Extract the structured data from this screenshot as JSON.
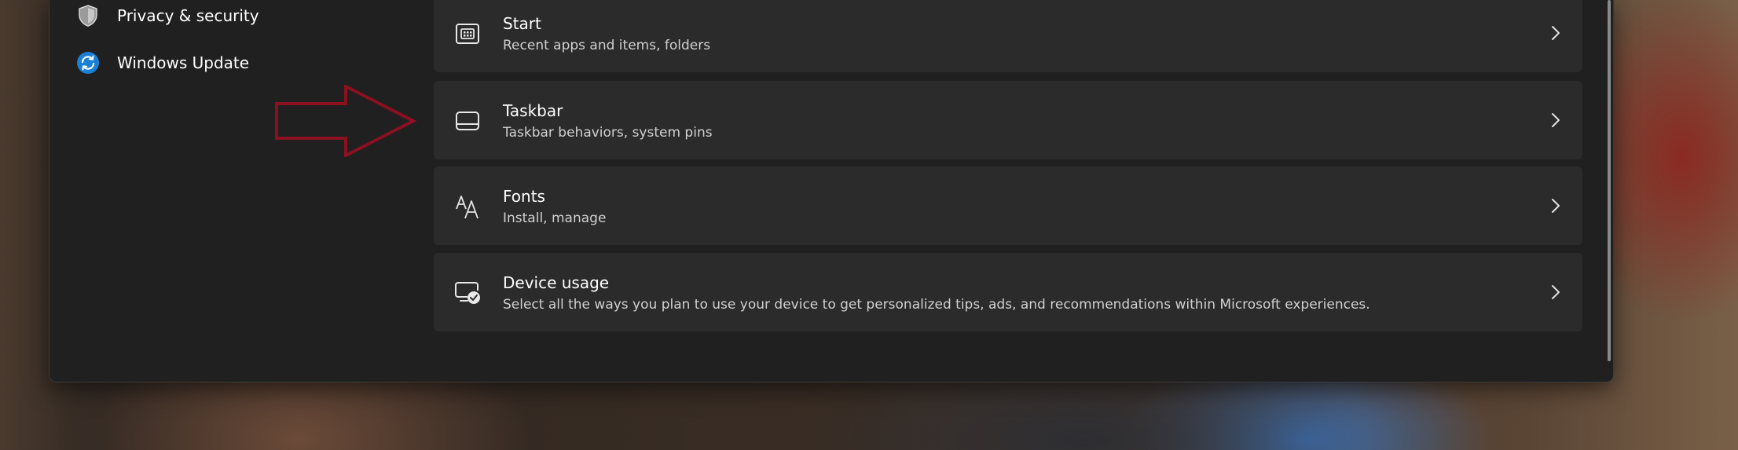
{
  "sidebar": {
    "items": [
      {
        "label": "Privacy & security",
        "icon": "shield-icon"
      },
      {
        "label": "Windows Update",
        "icon": "windows-update-icon"
      }
    ]
  },
  "settings": {
    "cards": [
      {
        "title": "Start",
        "subtitle": "Recent apps and items, folders",
        "icon": "start-menu-icon"
      },
      {
        "title": "Taskbar",
        "subtitle": "Taskbar behaviors, system pins",
        "icon": "taskbar-icon"
      },
      {
        "title": "Fonts",
        "subtitle": "Install, manage",
        "icon": "fonts-icon"
      },
      {
        "title": "Device usage",
        "subtitle": "Select all the ways you plan to use your device to get personalized tips, ads, and recommendations within Microsoft experiences.",
        "icon": "device-usage-icon"
      }
    ]
  },
  "colors": {
    "window_bg": "#202020",
    "card_bg": "#2b2b2b",
    "annotation_arrow": "#8b1020",
    "update_icon_blue": "#1a7fd6"
  }
}
